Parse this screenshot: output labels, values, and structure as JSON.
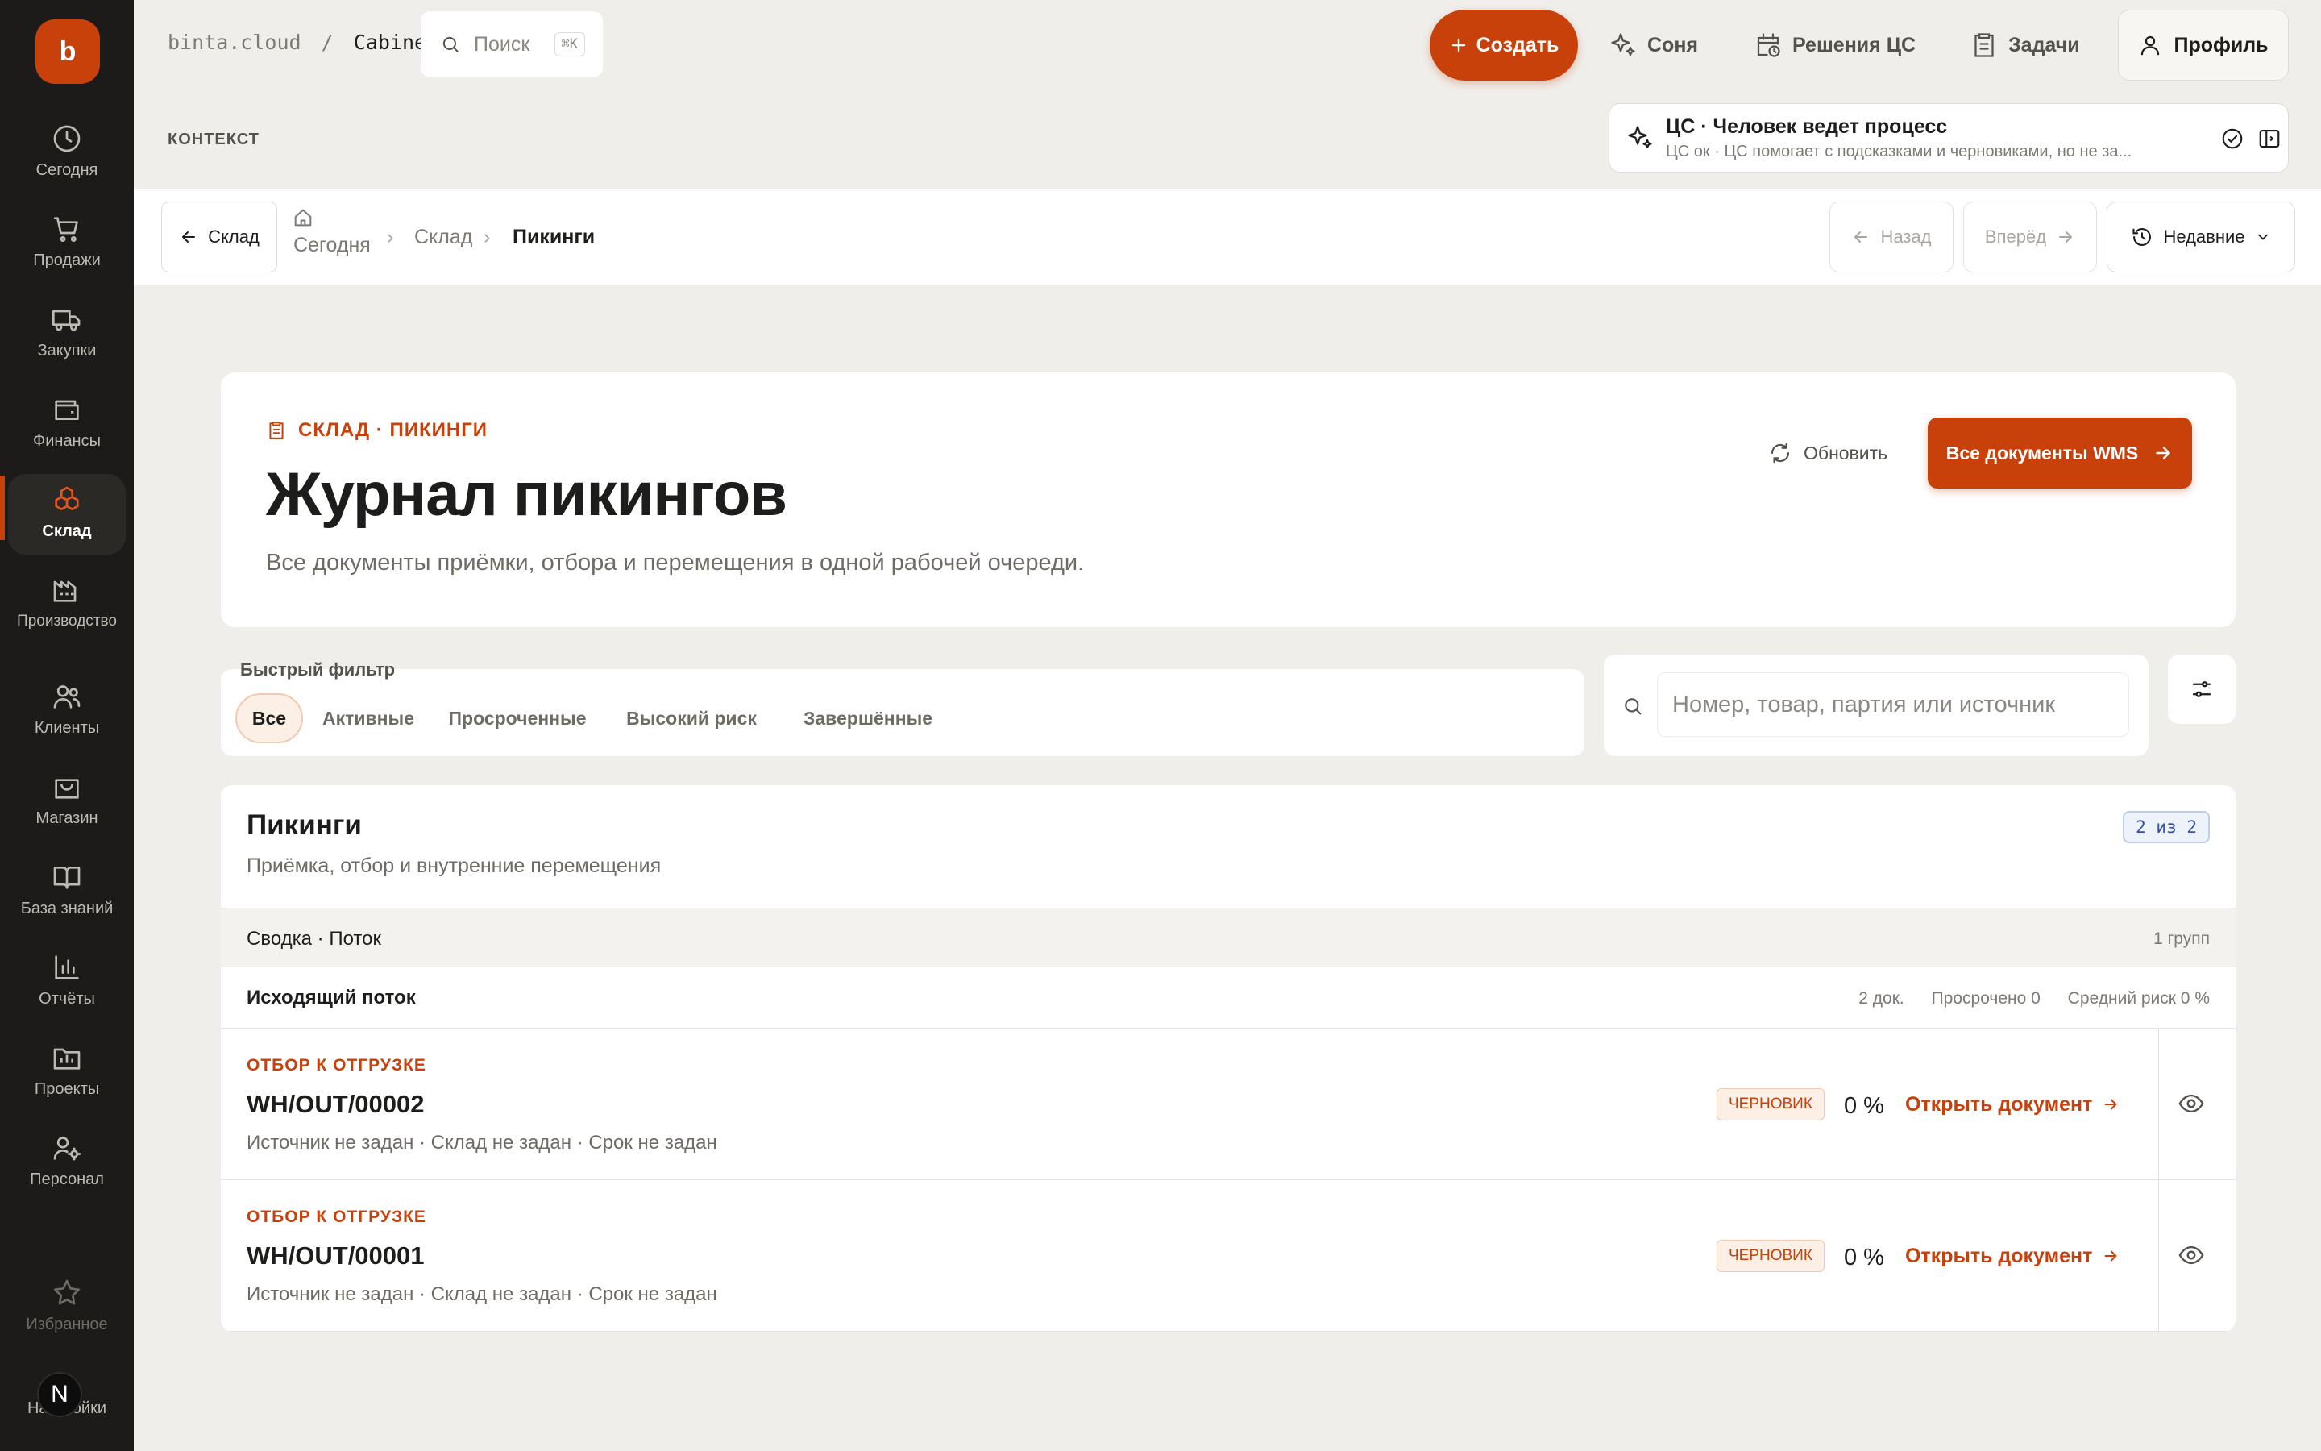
{
  "app": {
    "logo_letter": "b",
    "domain": "binta.cloud",
    "separator": "/",
    "workspace": "Cabinet"
  },
  "search": {
    "placeholder": "Поиск",
    "shortcut": "⌘K"
  },
  "sidebar": {
    "items": [
      {
        "label": "Сегодня",
        "icon": "clock-icon"
      },
      {
        "label": "Продажи",
        "icon": "cart-icon"
      },
      {
        "label": "Закупки",
        "icon": "truck-icon"
      },
      {
        "label": "Финансы",
        "icon": "wallet-icon"
      },
      {
        "label": "Склад",
        "icon": "boxes-icon",
        "active": true
      },
      {
        "label": "Производство",
        "icon": "factory-icon"
      },
      {
        "label": "Клиенты",
        "icon": "users-icon"
      },
      {
        "label": "Магазин",
        "icon": "bag-icon"
      },
      {
        "label": "База знаний",
        "icon": "book-icon"
      },
      {
        "label": "Отчёты",
        "icon": "chart-icon"
      },
      {
        "label": "Проекты",
        "icon": "folder-chart-icon"
      },
      {
        "label": "Персонал",
        "icon": "user-cog-icon"
      }
    ],
    "favorites": "Избранное",
    "settings": "Настройки",
    "user_initial": "N"
  },
  "topbar": {
    "create": "Создать",
    "sonya": "Соня",
    "decisions": "Решения ЦС",
    "tasks": "Задачи",
    "profile": "Профиль"
  },
  "context": {
    "label": "КОНТЕКСТ",
    "ai_title": "ЦС · Человек ведет процесс",
    "ai_subtitle": "ЦС ок · ЦС помогает с подсказками и черновиками, но не за..."
  },
  "navbar": {
    "back_folder": "Склад",
    "crumbs": [
      "Сегодня",
      "Склад",
      "Пикинги"
    ],
    "back": "Назад",
    "forward": "Вперёд",
    "recent": "Недавние"
  },
  "header": {
    "eyebrow": "СКЛАД · ПИКИНГИ",
    "title": "Журнал пикингов",
    "description": "Все документы приёмки, отбора и перемещения в одной рабочей очереди.",
    "refresh": "Обновить",
    "all_docs": "Все документы WMS"
  },
  "filters": {
    "label": "Быстрый фильтр",
    "chips": [
      "Все",
      "Активные",
      "Просроченные",
      "Высокий риск",
      "Завершённые"
    ],
    "active_index": 0,
    "search_placeholder": "Номер, товар, партия или источник"
  },
  "table": {
    "title": "Пикинги",
    "subtitle": "Приёмка, отбор и внутренние перемещения",
    "count_badge": "2 из 2",
    "summary_label": "Сводка · Поток",
    "summary_count": "1 групп",
    "group": {
      "name": "Исходящий поток",
      "docs": "2 док.",
      "overdue": "Просрочено 0",
      "avg_risk": "Средний риск 0 %"
    },
    "rows": [
      {
        "type": "ОТБОР К ОТГРУЗКЕ",
        "number": "WH/OUT/00002",
        "meta": "Источник не задан · Склад не задан · Срок не задан",
        "status": "ЧЕРНОВИК",
        "progress": "0 %",
        "open": "Открыть документ"
      },
      {
        "type": "ОТБОР К ОТГРУЗКЕ",
        "number": "WH/OUT/00001",
        "meta": "Источник не задан · Склад не задан · Срок не задан",
        "status": "ЧЕРНОВИК",
        "progress": "0 %",
        "open": "Открыть документ"
      }
    ]
  },
  "colors": {
    "accent": "#c8410b",
    "sidebar": "#1c1b19",
    "background": "#efeeea"
  }
}
